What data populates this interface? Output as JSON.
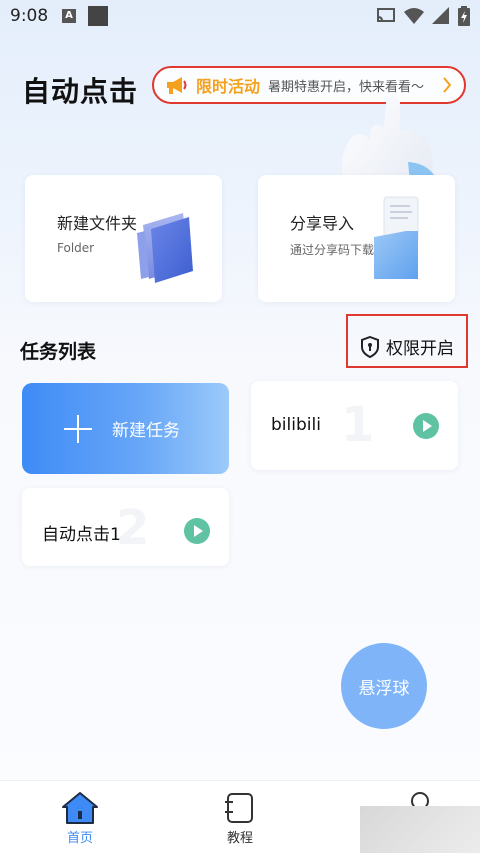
{
  "status_bar": {
    "time": "9:08",
    "notif_letter": "A"
  },
  "header": {
    "title": "自动点击"
  },
  "promo": {
    "title": "限时活动",
    "subtitle": "暑期特惠开启，快来看看～"
  },
  "cards": {
    "folder": {
      "title": "新建文件夹",
      "subtitle": "Folder"
    },
    "import": {
      "title": "分享导入",
      "subtitle": "通过分享码下载"
    }
  },
  "tasks_section": {
    "title": "任务列表",
    "permission_label": "权限开启"
  },
  "new_task": {
    "label": "新建任务"
  },
  "tasks": [
    {
      "name": "bilibili",
      "number": "1"
    },
    {
      "name": "自动点击1",
      "number": "2"
    }
  ],
  "float_ball": {
    "label": "悬浮球"
  },
  "bottom_nav": {
    "home": "首页",
    "tutorial": "教程"
  },
  "colors": {
    "accent": "#3e8bf6",
    "play": "#5fc2a2",
    "highlight_border": "#e0372f",
    "promo_title": "#f4a11d"
  }
}
